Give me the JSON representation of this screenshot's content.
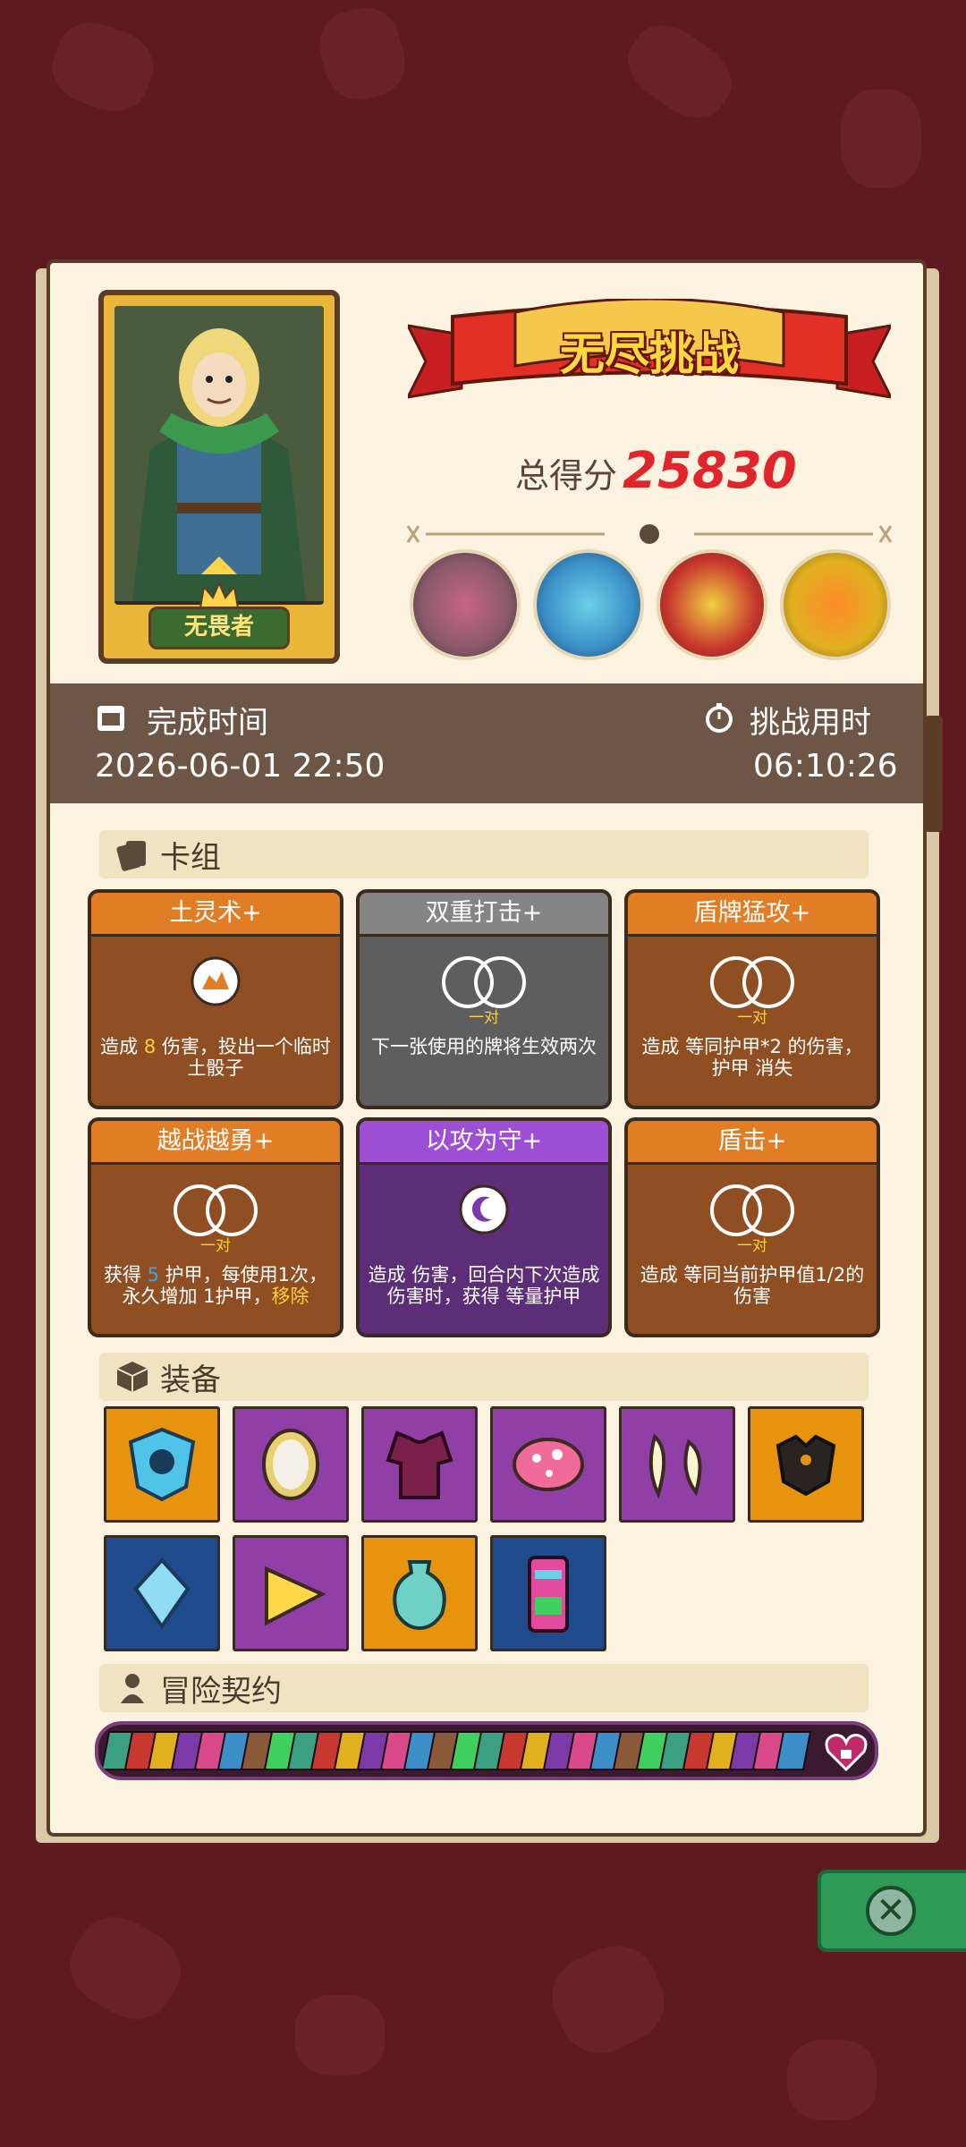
{
  "hero": {
    "name": "无畏者",
    "crown_icon": "crown-icon"
  },
  "header": {
    "title": "无尽挑战",
    "score_label": "总得分",
    "score_value": "25830"
  },
  "bosses": [
    {
      "name": "pink-rock-golem",
      "color": "#8a5a6a"
    },
    {
      "name": "blue-crowned-spider",
      "color": "#3b8fc6"
    },
    {
      "name": "red-bird-demon",
      "color": "#c8382e"
    },
    {
      "name": "sun-pumpkin",
      "color": "#e0b020"
    }
  ],
  "times": {
    "complete_label": "完成时间",
    "complete_value": "2026-06-01 22:50",
    "duration_label": "挑战用时",
    "duration_value": "06:10:26"
  },
  "deck": {
    "title": "卡组",
    "cards": [
      {
        "name": "土灵术+",
        "style": "orange",
        "icon": "rock-icon",
        "sub": "",
        "desc_parts": [
          "造成 ",
          "8",
          " 伤害，投出一个临时土骰子"
        ]
      },
      {
        "name": "双重打击+",
        "style": "gray",
        "icon": "pair-dice-icon",
        "sub": "一对",
        "desc": "下一张使用的牌将生效两次"
      },
      {
        "name": "盾牌猛攻+",
        "style": "orange",
        "icon": "pair-dice-icon",
        "sub": "一对",
        "desc": "造成 等同护甲*2 的伤害，护甲 消失"
      },
      {
        "name": "越战越勇+",
        "style": "orange",
        "icon": "pair-dice-icon",
        "sub": "一对",
        "desc_parts": [
          "获得 ",
          "5",
          " 护甲，每使用1次，永久增加 ",
          "1护甲，",
          "移除"
        ]
      },
      {
        "name": "以攻为守+",
        "style": "purple",
        "icon": "moon-icon",
        "sub": "",
        "desc": "造成 伤害，回合内下次造成伤害时，获得 等量护甲"
      },
      {
        "name": "盾击+",
        "style": "orange",
        "icon": "pair-dice-icon",
        "sub": "一对",
        "desc": "造成 等同当前护甲值1/2的伤害"
      }
    ]
  },
  "equipment": {
    "title": "装备",
    "items": [
      {
        "name": "blue-skull-shield",
        "bg": "orange"
      },
      {
        "name": "golden-mirror",
        "bg": "purple"
      },
      {
        "name": "crimson-armor",
        "bg": "purple"
      },
      {
        "name": "pink-mushroom",
        "bg": "purple"
      },
      {
        "name": "twin-fangs",
        "bg": "purple"
      },
      {
        "name": "dark-spiked-armor",
        "bg": "orange"
      },
      {
        "name": "blue-crystal",
        "bg": "blue"
      },
      {
        "name": "cheese-wedge",
        "bg": "purple"
      },
      {
        "name": "turquoise-vase",
        "bg": "orange"
      },
      {
        "name": "tribal-totem",
        "bg": "blue"
      }
    ]
  },
  "contracts": {
    "title": "冒险契约",
    "count": 30
  },
  "colors": {
    "background": "#5e1a1f",
    "panel": "#fbf3df",
    "score": "#e0262c",
    "accent_yellow": "#ffcf3a",
    "shield_blue": "#3aa5e8"
  }
}
